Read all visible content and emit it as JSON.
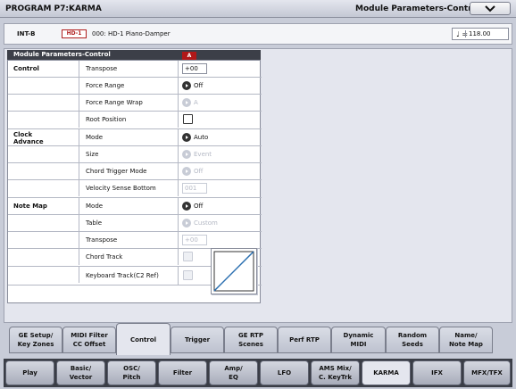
{
  "title": {
    "program": "PROGRAM P7:KARMA",
    "page": "Module Parameters-Control",
    "menu_icon": "chevron-down-icon"
  },
  "header": {
    "bank": "INT-B",
    "badge": "HD-1",
    "program_name": "000: HD-1 Piano-Damper",
    "tempo_symbol": "♩ =",
    "tempo": "118.00"
  },
  "panel": {
    "title": "Module Parameters-Control",
    "marker": "A"
  },
  "sections": {
    "control": "Control",
    "clock_advance": "Clock\nAdvance",
    "note_map": "Note Map"
  },
  "params": {
    "control_transpose": {
      "label": "Transpose",
      "value": "+00"
    },
    "force_range": {
      "label": "Force Range",
      "value": "Off"
    },
    "force_range_wrap": {
      "label": "Force Range Wrap",
      "value": "A"
    },
    "root_position": {
      "label": "Root Position",
      "checked": false
    },
    "clock_mode": {
      "label": "Mode",
      "value": "Auto"
    },
    "clock_size": {
      "label": "Size",
      "value": "Event"
    },
    "chord_trigger_mode": {
      "label": "Chord Trigger Mode",
      "value": "Off"
    },
    "velocity_sense_bottom": {
      "label": "Velocity Sense Bottom",
      "value": "001"
    },
    "notemap_mode": {
      "label": "Mode",
      "value": "Off"
    },
    "notemap_table": {
      "label": "Table",
      "value": "Custom"
    },
    "notemap_transpose": {
      "label": "Transpose",
      "value": "+00"
    },
    "chord_track": {
      "label": "Chord Track",
      "checked": false
    },
    "keyboard_track": {
      "label": "Keyboard Track(C2 Ref)",
      "checked": false
    }
  },
  "sub_tabs": [
    "GE Setup/\nKey Zones",
    "MIDI Filter\nCC Offset",
    "Control",
    "Trigger",
    "GE RTP\nScenes",
    "Perf RTP",
    "Dynamic\nMIDI",
    "Random\nSeeds",
    "Name/\nNote Map"
  ],
  "sub_tab_active": "Control",
  "page_tabs": [
    "Play",
    "Basic/\nVector",
    "OSC/\nPitch",
    "Filter",
    "Amp/\nEQ",
    "LFO",
    "AMS Mix/\nC. KeyTrk",
    "KARMA",
    "IFX",
    "MFX/TFX"
  ],
  "page_tab_active": "KARMA",
  "colors": {
    "marker_red": "#b01818",
    "curve_line": "#2a6fb0",
    "panel_header": "#3c3f48"
  }
}
